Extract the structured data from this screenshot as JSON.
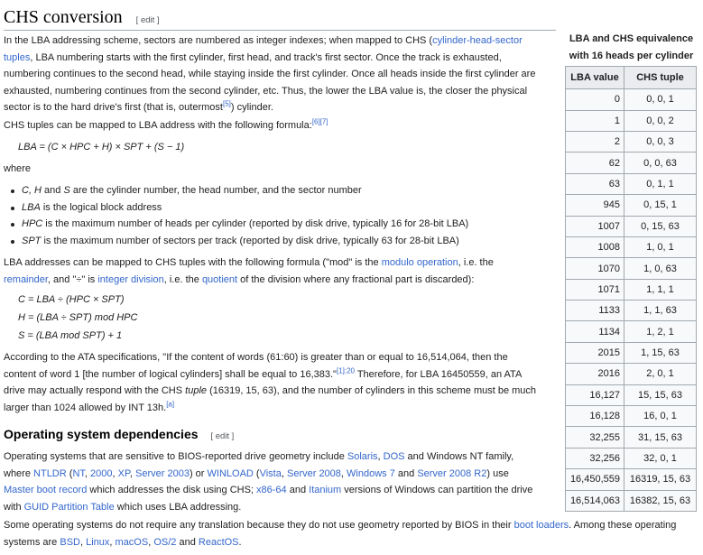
{
  "sec1": {
    "title": "CHS conversion",
    "edit": "[ edit ]",
    "p1": {
      "t1": "In the LBA addressing scheme, sectors are numbered as integer indexes; when mapped to CHS (",
      "l1a": "cylinder-head-sector",
      "l1b": "tuples",
      "t2": ", LBA numbering starts with the first cylinder, first head, and track's first sector. Once the track is exhausted,",
      "t3": "numbering continues to the second head, while staying inside the first cylinder. Once all heads inside the first cylinder are",
      "t4": "exhausted, numbering continues from the second cylinder, etc. Thus, the lower the LBA value is, the closer the physical",
      "t5": "sector is to the hard drive's first (that is, outermost",
      "ref": "[5]",
      "t6": ") cylinder."
    },
    "p2": {
      "text": "CHS tuples can be mapped to LBA address with the following formula:",
      "ref": "[6][7]"
    },
    "formula1": "LBA = (C × HPC + H) × SPT + (S − 1)",
    "where": "where",
    "list": [
      {
        "i": "C, H",
        "m": " and ",
        "i2": "S",
        "t": " are the cylinder number, the head number, and the sector number"
      },
      {
        "i": "LBA",
        "m": "",
        "i2": "",
        "t": " is the logical block address"
      },
      {
        "i": "HPC",
        "m": "",
        "i2": "",
        "t": " is the maximum number of heads per cylinder (reported by disk drive, typically 16 for 28-bit LBA)"
      },
      {
        "i": "SPT",
        "m": "",
        "i2": "",
        "t": " is the maximum number of sectors per track (reported by disk drive, typically 63 for 28-bit LBA)"
      }
    ],
    "p3": {
      "t1": "LBA addresses can be mapped to CHS tuples with the following formula (\"mod\" is the ",
      "l1": "modulo operation",
      "t2": ", i.e. the",
      "l2": "remainder",
      "t3": ", and \"÷\" is ",
      "l3": "integer division",
      "t4": ", i.e. the ",
      "l4": "quotient",
      "t5": " of the division where any fractional part is discarded):"
    },
    "formulas": [
      "C = LBA ÷ (HPC × SPT)",
      "H = (LBA ÷ SPT) mod HPC",
      "S = (LBA mod SPT) + 1"
    ],
    "p4": {
      "t1": "According to the ATA specifications, \"If the content of words (61:60) is greater than or equal to 16,514,064, then the",
      "t2": "content of word 1 [the number of logical cylinders] shall be equal to 16,383.\"",
      "ref": "[1]:20",
      "t3": " Therefore, for LBA 16450559, an ATA",
      "t4a": "drive may actually respond with the CHS ",
      "t4i": "tuple",
      "t4b": " (16319, 15, 63), and the number of cylinders in this scheme must be much",
      "t5": "larger than 1024 allowed by INT 13h.",
      "ref2": "[a]"
    }
  },
  "sec2": {
    "title": "Operating system dependencies",
    "edit": "[ edit ]",
    "p1": {
      "a": "Operating systems that are sensitive to BIOS-reported drive geometry include ",
      "solaris": "Solaris",
      "b": ", ",
      "dos": "DOS",
      "c": " and Windows NT family,",
      "d": "where ",
      "ntldr": "NTLDR",
      "e": " (",
      "nt": "NT",
      "f": ", ",
      "w2000": "2000",
      "g": ", ",
      "xp": "XP",
      "h": ", ",
      "s2003": "Server 2003",
      "i": ") or ",
      "winload": "WINLOAD",
      "j": " (",
      "vista": "Vista",
      "k": ", ",
      "s2008": "Server 2008",
      "l": ", ",
      "win7": "Windows 7",
      "m": " and ",
      "s2008r2": "Server 2008 R2",
      "n": ") use",
      "mbr": "Master boot record",
      "o": " which addresses the disk using CHS; ",
      "x8664": "x86-64",
      "p": " and ",
      "itanium": "Itanium",
      "q": " versions of Windows can partition the drive",
      "r": "with ",
      "gpt": "GUID Partition Table",
      "s": " which uses LBA addressing."
    },
    "p2": {
      "a": "Some operating systems do not require any translation because they do not use geometry reported by BIOS in their ",
      "boot": "boot loaders",
      "b": ". Among these operating",
      "c": "systems are ",
      "bsd": "BSD",
      "d": ", ",
      "linux": "Linux",
      "e": ", ",
      "macos": "macOS",
      "f": ", ",
      "os2": "OS/2",
      "g": " and ",
      "reactos": "ReactOS",
      "h": "."
    }
  },
  "table": {
    "caption1": "LBA and CHS equivalence",
    "caption2": "with 16 heads per cylinder",
    "headers": [
      "LBA value",
      "CHS tuple"
    ],
    "rows": [
      [
        "0",
        "0, 0, 1"
      ],
      [
        "1",
        "0, 0, 2"
      ],
      [
        "2",
        "0, 0, 3"
      ],
      [
        "62",
        "0, 0, 63"
      ],
      [
        "63",
        "0, 1, 1"
      ],
      [
        "945",
        "0, 15, 1"
      ],
      [
        "1007",
        "0, 15, 63"
      ],
      [
        "1008",
        "1, 0, 1"
      ],
      [
        "1070",
        "1, 0, 63"
      ],
      [
        "1071",
        "1, 1, 1"
      ],
      [
        "1133",
        "1, 1, 63"
      ],
      [
        "1134",
        "1, 2, 1"
      ],
      [
        "2015",
        "1, 15, 63"
      ],
      [
        "2016",
        "2, 0, 1"
      ],
      [
        "16,127",
        "15, 15, 63"
      ],
      [
        "16,128",
        "16, 0, 1"
      ],
      [
        "32,255",
        "31, 15, 63"
      ],
      [
        "32,256",
        "32, 0, 1"
      ],
      [
        "16,450,559",
        "16319, 15, 63"
      ],
      [
        "16,514,063",
        "16382, 15, 63"
      ]
    ]
  }
}
